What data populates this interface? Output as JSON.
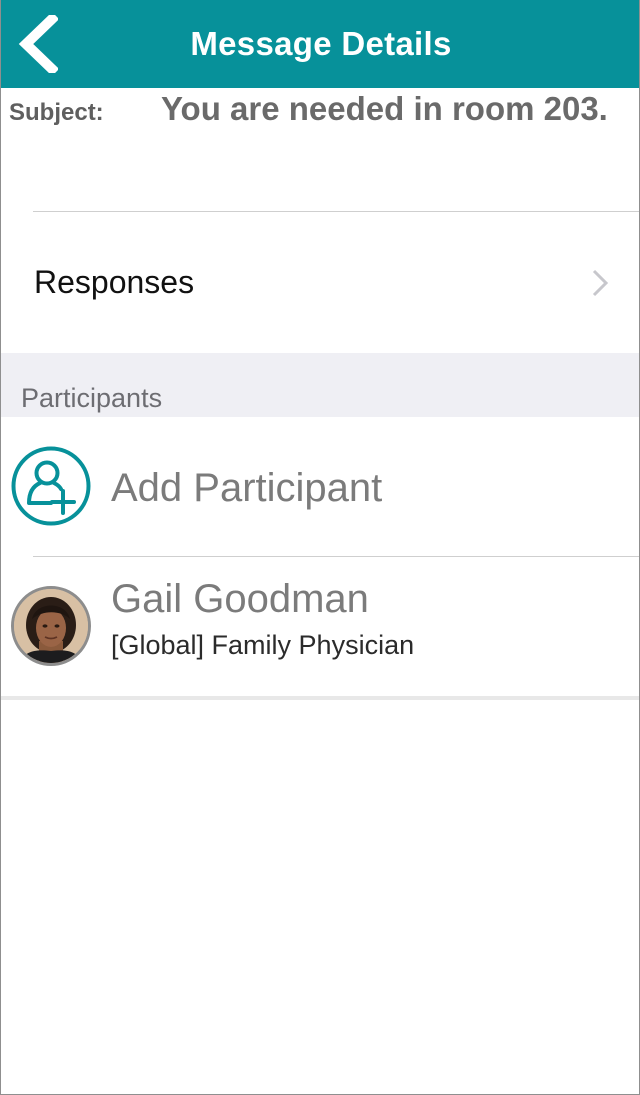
{
  "navbar": {
    "title": "Message Details",
    "back_icon": "chevron-left-icon",
    "color": "#07919a"
  },
  "subject": {
    "label": "Subject:",
    "value": "You are needed in room 203."
  },
  "responses": {
    "label": "Responses",
    "icon": "chevron-right-icon"
  },
  "participants": {
    "section_title": "Participants",
    "add": {
      "label": "Add Participant",
      "icon": "add-person-icon"
    },
    "items": [
      {
        "name": "Gail Goodman",
        "role": "[Global] Family Physician",
        "avatar": "avatar"
      }
    ]
  }
}
